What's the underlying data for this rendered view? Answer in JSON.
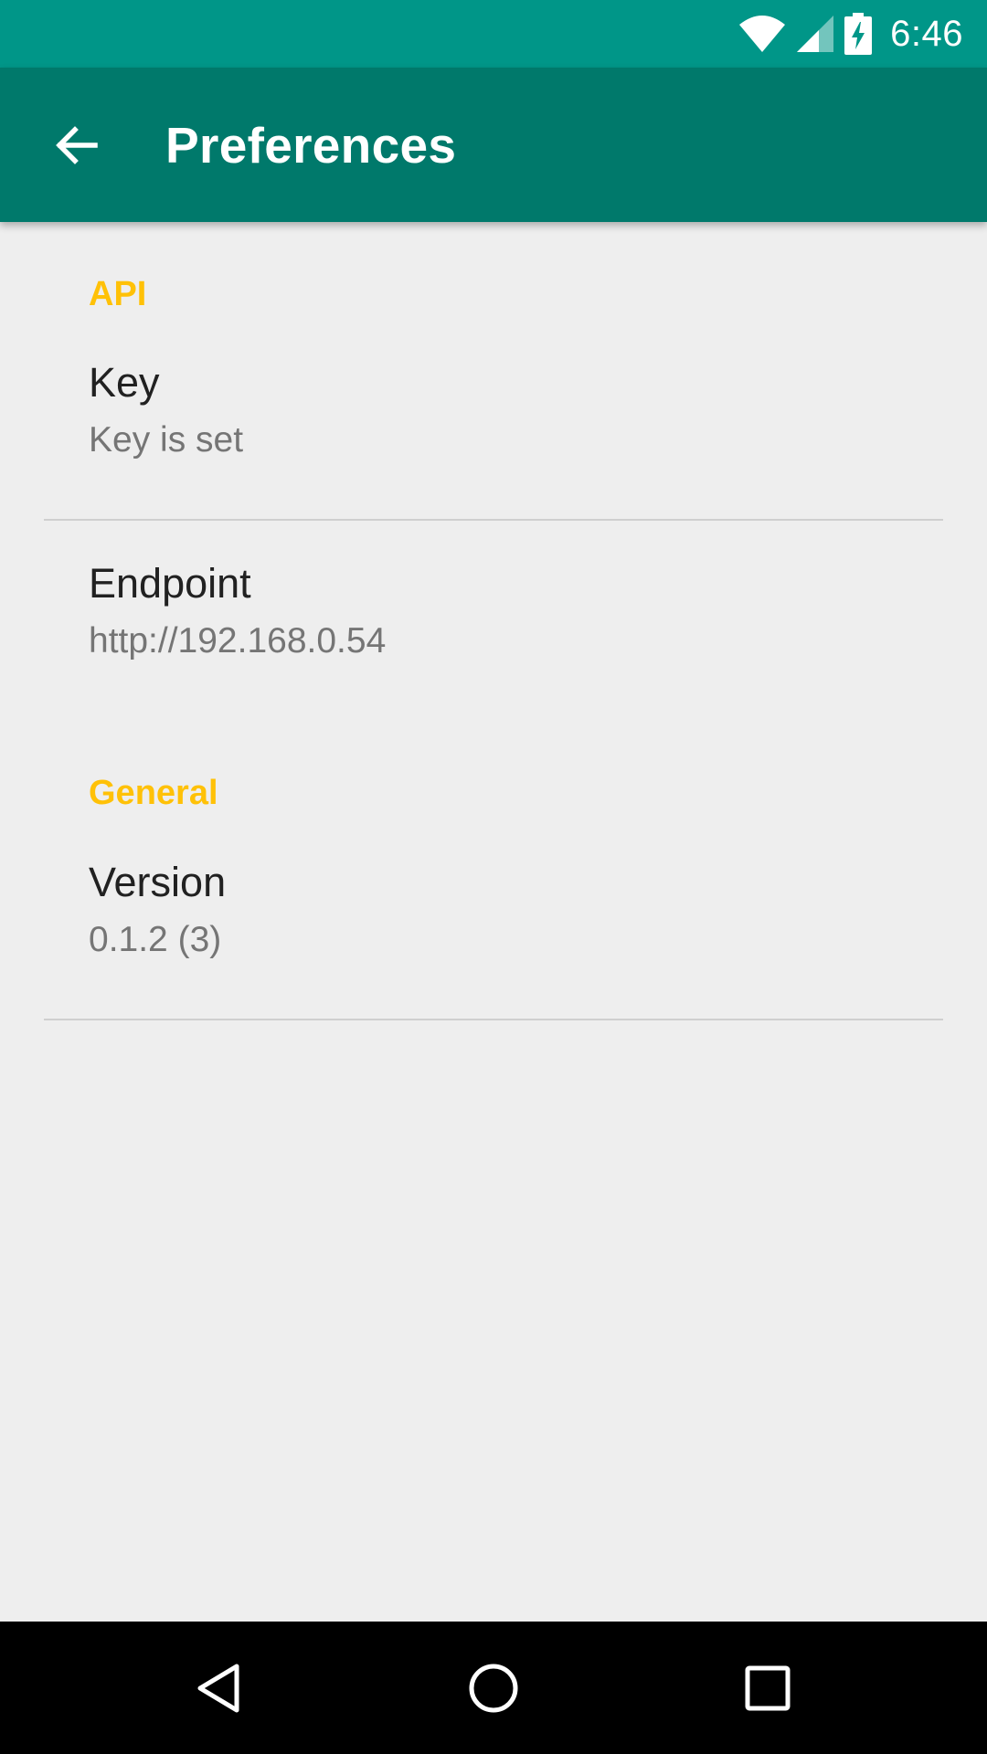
{
  "status_bar": {
    "time": "6:46",
    "icons": [
      "wifi-icon",
      "cell-signal-icon",
      "battery-charging-icon"
    ]
  },
  "app_bar": {
    "title": "Preferences",
    "back_icon": "arrow-back-icon"
  },
  "categories": [
    {
      "title": "API",
      "items": [
        {
          "title": "Key",
          "summary": "Key is set"
        },
        {
          "title": "Endpoint",
          "summary": "http://192.168.0.54"
        }
      ]
    },
    {
      "title": "General",
      "items": [
        {
          "title": "Version",
          "summary": "0.1.2 (3)"
        }
      ]
    }
  ],
  "nav_bar": {
    "icons": [
      "back-triangle-icon",
      "home-circle-icon",
      "recents-square-icon"
    ]
  },
  "colors": {
    "status_bar": "#009688",
    "app_bar": "#00796b",
    "accent": "#ffc107",
    "background": "#eeeeee"
  }
}
